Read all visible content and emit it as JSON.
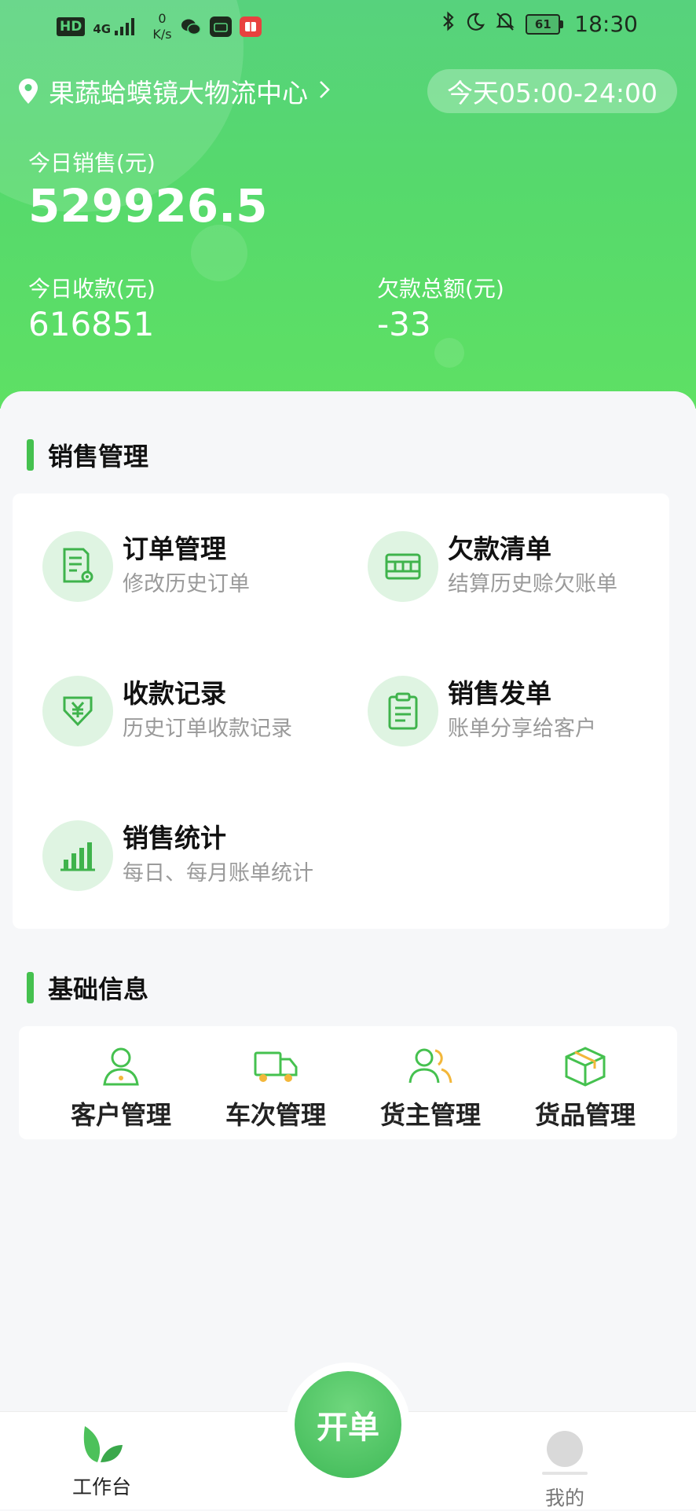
{
  "status_bar": {
    "hd": "HD",
    "signal": "4G",
    "speed_value": "0",
    "speed_unit": "K/s",
    "battery": "61",
    "time": "18:30"
  },
  "header": {
    "location": "果蔬蛤蟆镜大物流中心",
    "hours": "今天05:00-24:00"
  },
  "stats": {
    "sales_label": "今日销售(元)",
    "sales_value": "529926.5",
    "received_label": "今日收款(元)",
    "received_value": "616851",
    "debt_label": "欠款总额(元)",
    "debt_value": "-33"
  },
  "sales_section": {
    "title": "销售管理",
    "items": [
      {
        "title": "订单管理",
        "subtitle": "修改历史订单",
        "icon": "order-document-icon"
      },
      {
        "title": "欠款清单",
        "subtitle": "结算历史赊欠账单",
        "icon": "debt-card-icon"
      },
      {
        "title": "收款记录",
        "subtitle": "历史订单收款记录",
        "icon": "yuan-receive-icon"
      },
      {
        "title": "销售发单",
        "subtitle": "账单分享给客户",
        "icon": "clipboard-icon"
      },
      {
        "title": "销售统计",
        "subtitle": "每日、每月账单统计",
        "icon": "bar-chart-icon"
      }
    ]
  },
  "info_section": {
    "title": "基础信息",
    "items": [
      {
        "label": "客户管理",
        "icon": "customer-icon"
      },
      {
        "label": "车次管理",
        "icon": "truck-icon"
      },
      {
        "label": "货主管理",
        "icon": "owners-icon"
      },
      {
        "label": "货品管理",
        "icon": "box-icon"
      }
    ]
  },
  "nav": {
    "workbench": "工作台",
    "create_order": "开单",
    "mine": "我的"
  },
  "colors": {
    "brand_green": "#45c14f",
    "header_green": "#56d96c",
    "icon_bg": "#dff4e2"
  }
}
